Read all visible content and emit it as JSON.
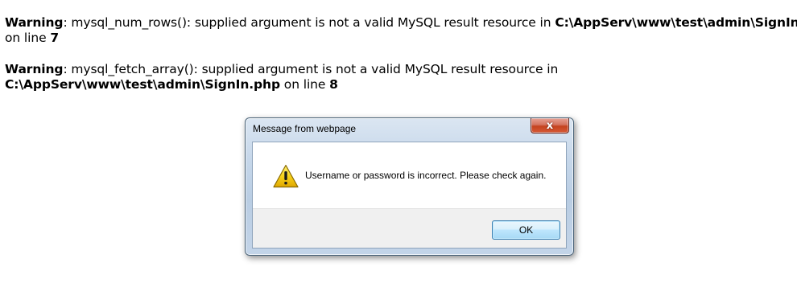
{
  "warnings": [
    {
      "label": "Warning",
      "message": ": mysql_num_rows(): supplied argument is not a valid MySQL result resource in ",
      "path": "C:\\AppServ\\www\\test\\admin\\SignIn.php",
      "line_prefix": "on line ",
      "line": "7"
    },
    {
      "label": "Warning",
      "message": ": mysql_fetch_array(): supplied argument is not a valid MySQL result resource in",
      "path": "C:\\AppServ\\www\\test\\admin\\SignIn.php",
      "line_prefix": " on line ",
      "line": "8"
    }
  ],
  "dialog": {
    "title": "Message from webpage",
    "close_glyph": "x",
    "icon": "warning-triangle-icon",
    "message": "Username or password is incorrect. Please check again.",
    "ok_label": "OK"
  },
  "colors": {
    "warning_icon_fill": "#f5c400",
    "close_button": "#c5421f",
    "ok_button_border": "#3c7fb1"
  }
}
